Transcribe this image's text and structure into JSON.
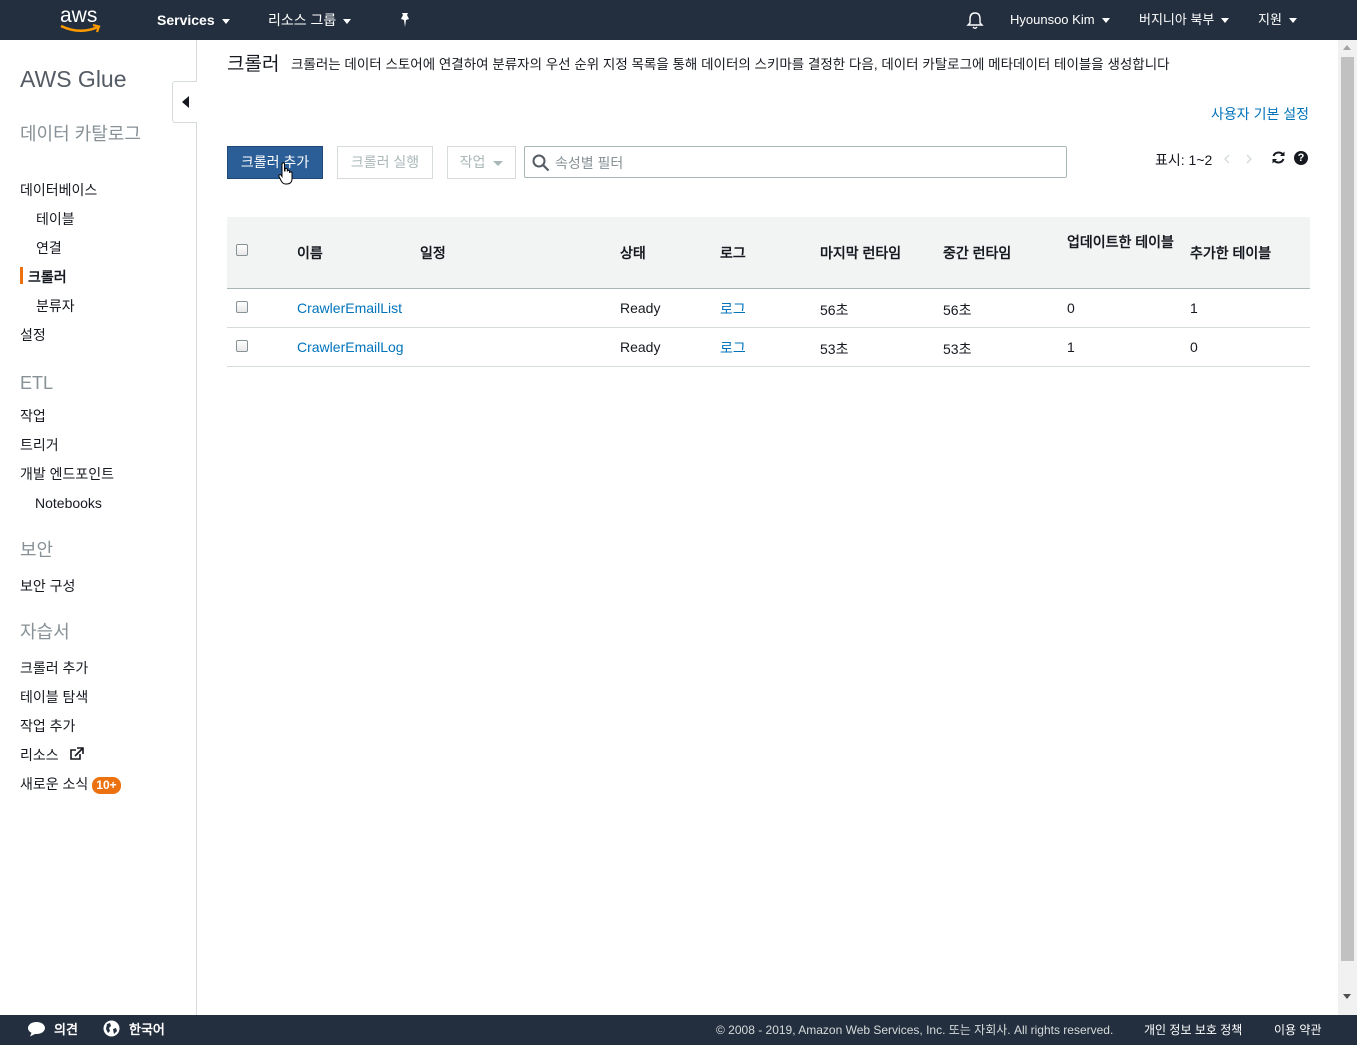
{
  "topnav": {
    "logo_text": "aws",
    "services_label": "Services",
    "resource_groups_label": "리소스 그룹",
    "user_label": "Hyounsoo Kim",
    "region_label": "버지니아 북부",
    "support_label": "지원",
    "bg_color": "#232f3e"
  },
  "sidebar": {
    "title": "AWS Glue",
    "data_catalog_section": "데이터 카탈로그",
    "databases": "데이터베이스",
    "tables": "테이블",
    "connections": "연결",
    "crawlers": "크롤러",
    "classifiers": "분류자",
    "settings": "설정",
    "etl_section": "ETL",
    "jobs": "작업",
    "triggers": "트리거",
    "dev_endpoints": "개발 엔드포인트",
    "notebooks": "Notebooks",
    "security_section": "보안",
    "security_config": "보안 구성",
    "tutorials_section": "자습서",
    "add_crawler": "크롤러 추가",
    "explore_table": "테이블 탐색",
    "add_job": "작업 추가",
    "resources": "리소스",
    "whats_new": "새로운 소식",
    "whats_new_badge": "10+",
    "accent_color": "#ec7211"
  },
  "main": {
    "title": "크롤러",
    "description": "크롤러는 데이터 스토어에 연결하여 분류자의 우선 순위 지정 목록을 통해 데이터의 스키마를 결정한 다음, 데이터 카탈로그에 메타데이터 테이블을 생성합니다",
    "preferences_link": "사용자 기본 설정",
    "add_crawler_button": "크롤러 추가",
    "run_crawler_button": "크롤러 실행",
    "action_button": "작업",
    "filter_placeholder": "속성별 필터",
    "pager_text": "표시: 1~2",
    "primary_color": "#2b5d96",
    "link_color": "#0073bb"
  },
  "table": {
    "headers": {
      "name": "이름",
      "schedule": "일정",
      "status": "상태",
      "logs": "로그",
      "last_runtime": "마지막 런타임",
      "median_runtime": "중간 런타임",
      "tables_updated": "업데이트한 테이블",
      "tables_added": "추가한 테이블"
    },
    "rows": [
      {
        "name": "CrawlerEmailList",
        "schedule": "",
        "status": "Ready",
        "logs": "로그",
        "last_runtime": "56초",
        "median_runtime": "56초",
        "tables_updated": "0",
        "tables_added": "1"
      },
      {
        "name": "CrawlerEmailLog",
        "schedule": "",
        "status": "Ready",
        "logs": "로그",
        "last_runtime": "53초",
        "median_runtime": "53초",
        "tables_updated": "1",
        "tables_added": "0"
      }
    ]
  },
  "footer": {
    "feedback": "의견",
    "language": "한국어",
    "copyright": "© 2008 - 2019, Amazon Web Services, Inc. 또는 자회사. All rights reserved.",
    "privacy": "개인 정보 보호 정책",
    "terms": "이용 약관"
  }
}
